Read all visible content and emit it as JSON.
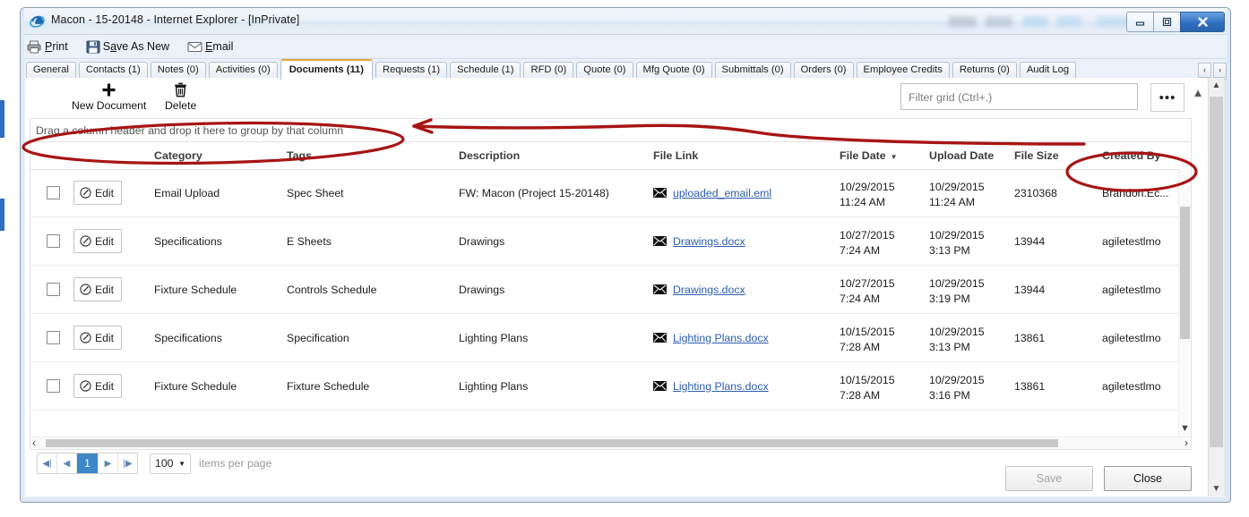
{
  "window": {
    "title": "Macon - 15-20148 - Internet Explorer - [InPrivate]",
    "icon": "internet-explorer-icon",
    "minimize_label": "Minimize",
    "restore_label": "Restore",
    "close_label": "Close"
  },
  "commandbar": {
    "items": [
      {
        "label": "Print",
        "accel": "P",
        "icon": "printer-icon"
      },
      {
        "label": "Save As New",
        "accel": "A",
        "icon": "save-icon"
      },
      {
        "label": "Email",
        "accel": "E",
        "icon": "envelope-icon"
      }
    ]
  },
  "tabs": [
    {
      "label": "General",
      "active": false
    },
    {
      "label": "Contacts (1)",
      "active": false
    },
    {
      "label": "Notes (0)",
      "active": false
    },
    {
      "label": "Activities (0)",
      "active": false
    },
    {
      "label": "Documents (11)",
      "active": true
    },
    {
      "label": "Requests (1)",
      "active": false
    },
    {
      "label": "Schedule (1)",
      "active": false
    },
    {
      "label": "RFD (0)",
      "active": false
    },
    {
      "label": "Quote (0)",
      "active": false
    },
    {
      "label": "Mfg Quote (0)",
      "active": false
    },
    {
      "label": "Submittals (0)",
      "active": false
    },
    {
      "label": "Orders (0)",
      "active": false
    },
    {
      "label": "Employee Credits",
      "active": false
    },
    {
      "label": "Returns (0)",
      "active": false
    },
    {
      "label": "Audit Log",
      "active": false
    }
  ],
  "tabnav": {
    "prev": "‹",
    "next": "›"
  },
  "toolbar": {
    "new_document_label": "New Document",
    "new_document_icon": "plus-icon",
    "delete_label": "Delete",
    "delete_icon": "trash-icon",
    "filter_placeholder": "Filter grid (Ctrl+.)",
    "filter_value": "",
    "more_label": "•••",
    "collapse_icon": "chevron-up-icon"
  },
  "grid": {
    "group_hint": "Drag a column header and drop it here to group by that column",
    "columns": [
      {
        "label": "",
        "key": "select"
      },
      {
        "label": "",
        "key": "edit"
      },
      {
        "label": "Category",
        "key": "category"
      },
      {
        "label": "Tags",
        "key": "tags"
      },
      {
        "label": "Description",
        "key": "description"
      },
      {
        "label": "File Link",
        "key": "file_link"
      },
      {
        "label": "File Date",
        "key": "file_date",
        "sort": "desc",
        "sort_indicator": "▼"
      },
      {
        "label": "Upload Date",
        "key": "upload_date"
      },
      {
        "label": "File Size",
        "key": "file_size"
      },
      {
        "label": "Created By",
        "key": "created_by"
      }
    ],
    "edit_label": "Edit",
    "edit_icon": "pencil-circle-icon",
    "link_icon": "envelope-icon",
    "rows": [
      {
        "category": "Email Upload",
        "tags": "Spec Sheet",
        "description": "FW: Macon (Project 15-20148)",
        "file_link": "uploaded_email.eml",
        "file_date": "10/29/2015",
        "file_time": "11:24 AM",
        "upload_date": "10/29/2015",
        "upload_time": "11:24 AM",
        "file_size": "2310368",
        "created_by": "Brandon.Ec..."
      },
      {
        "category": "Specifications",
        "tags": "E Sheets",
        "description": "Drawings",
        "file_link": "Drawings.docx",
        "file_date": "10/27/2015",
        "file_time": "7:24 AM",
        "upload_date": "10/29/2015",
        "upload_time": "3:13 PM",
        "file_size": "13944",
        "created_by": "agiletestlmo"
      },
      {
        "category": "Fixture Schedule",
        "tags": "Controls Schedule",
        "description": "Drawings",
        "file_link": "Drawings.docx",
        "file_date": "10/27/2015",
        "file_time": "7:24 AM",
        "upload_date": "10/29/2015",
        "upload_time": "3:19 PM",
        "file_size": "13944",
        "created_by": "agiletestlmo"
      },
      {
        "category": "Specifications",
        "tags": "Specification",
        "description": "Lighting Plans",
        "file_link": "Lighting Plans.docx",
        "file_date": "10/15/2015",
        "file_time": "7:28 AM",
        "upload_date": "10/29/2015",
        "upload_time": "3:13 PM",
        "file_size": "13861",
        "created_by": "agiletestlmo"
      },
      {
        "category": "Fixture Schedule",
        "tags": "Fixture Schedule",
        "description": "Lighting Plans",
        "file_link": "Lighting Plans.docx",
        "file_date": "10/15/2015",
        "file_time": "7:28 AM",
        "upload_date": "10/29/2015",
        "upload_time": "3:16 PM",
        "file_size": "13861",
        "created_by": "agiletestlmo"
      }
    ]
  },
  "pager": {
    "first": "◀|",
    "prev": "◀",
    "page": "1",
    "next": "▶",
    "last": "|▶",
    "page_size": "100",
    "page_size_caret": "▼",
    "items_per_page_label": "items per page"
  },
  "footer": {
    "save_label": "Save",
    "close_label": "Close"
  },
  "annotations": {
    "color": "#a81414",
    "shapes": [
      "ellipse-group-bar",
      "arrow-to-group-bar",
      "ellipse-created-by"
    ]
  }
}
